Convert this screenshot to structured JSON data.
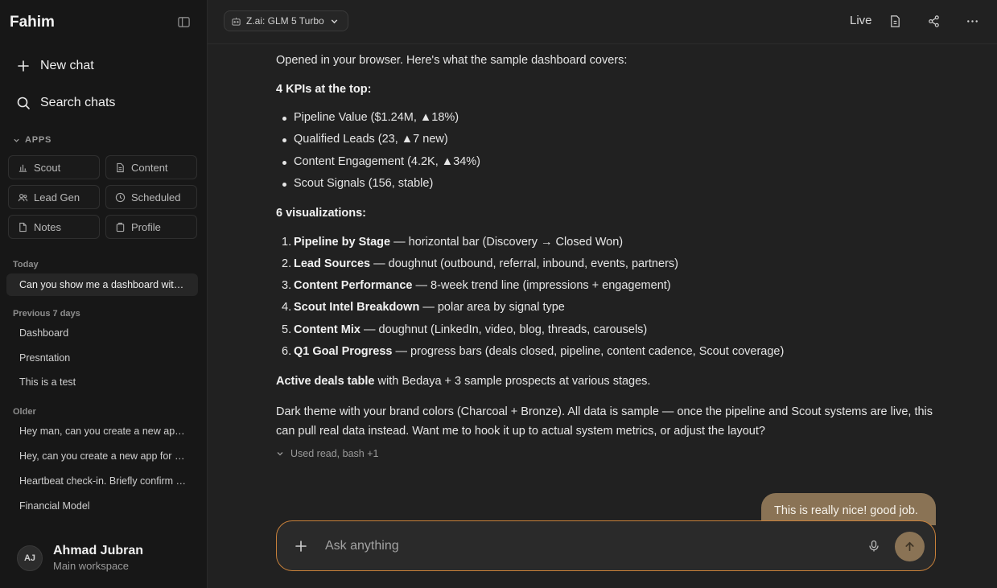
{
  "sidebar": {
    "brand": "Fahim",
    "new_chat": "New chat",
    "search_chats": "Search chats",
    "apps_label": "APPS",
    "apps": [
      {
        "label": "Scout",
        "icon": "bar-chart-icon"
      },
      {
        "label": "Content",
        "icon": "document-icon"
      },
      {
        "label": "Lead Gen",
        "icon": "users-icon"
      },
      {
        "label": "Scheduled",
        "icon": "clock-icon"
      },
      {
        "label": "Notes",
        "icon": "page-icon"
      },
      {
        "label": "Profile",
        "icon": "building-icon"
      }
    ],
    "today_label": "Today",
    "today": [
      "Can you show me a dashboard with some sample data"
    ],
    "prev7_label": "Previous 7 days",
    "prev7": [
      "Dashboard",
      "Presntation",
      "This is a test"
    ],
    "older_label": "Older",
    "older": [
      "Hey man, can you create a new app for me",
      "Hey, can you create a new app for tracking",
      "Heartbeat check-in. Briefly confirm status",
      "Financial Model"
    ],
    "user": {
      "initials": "AJ",
      "name": "Ahmad Jubran",
      "workspace": "Main workspace"
    }
  },
  "topbar": {
    "model": "Z.ai: GLM 5 Turbo",
    "live": "Live"
  },
  "message": {
    "intro": "Opened in your browser. Here's what the sample dashboard covers:",
    "kpi_heading": "4 KPIs at the top:",
    "kpis": [
      "Pipeline Value ($1.24M, ▲18%)",
      "Qualified Leads (23, ▲7 new)",
      "Content Engagement (4.2K, ▲34%)",
      "Scout Signals (156, stable)"
    ],
    "viz_heading": "6 visualizations:",
    "viz": [
      {
        "num": "1.",
        "title": "Pipeline by Stage",
        "desc": " — horizontal bar (Discovery → Closed Won)"
      },
      {
        "num": "2.",
        "title": "Lead Sources",
        "desc": " — doughnut (outbound, referral, inbound, events, partners)"
      },
      {
        "num": "3.",
        "title": "Content Performance",
        "desc": " — 8-week trend line (impressions + engagement)"
      },
      {
        "num": "4.",
        "title": "Scout Intel Breakdown",
        "desc": " — polar area by signal type"
      },
      {
        "num": "5.",
        "title": "Content Mix",
        "desc": " — doughnut (LinkedIn, video, blog, threads, carousels)"
      },
      {
        "num": "6.",
        "title": "Q1 Goal Progress",
        "desc": " — progress bars (deals closed, pipeline, content cadence, Scout coverage)"
      }
    ],
    "deals_bold": "Active deals table",
    "deals_rest": " with Bedaya + 3 sample prospects at various stages.",
    "closing": "Dark theme with your brand colors (Charcoal + Bronze). All data is sample — once the pipeline and Scout systems are live, this can pull real data instead. Want me to hook it up to actual system metrics, or adjust the layout?",
    "used_tools": "Used read, bash +1"
  },
  "user_message": "This is really nice! good job.",
  "composer": {
    "placeholder": "Ask anything"
  },
  "colors": {
    "accent": "#8a7355",
    "composer_border": "#c7803a"
  }
}
